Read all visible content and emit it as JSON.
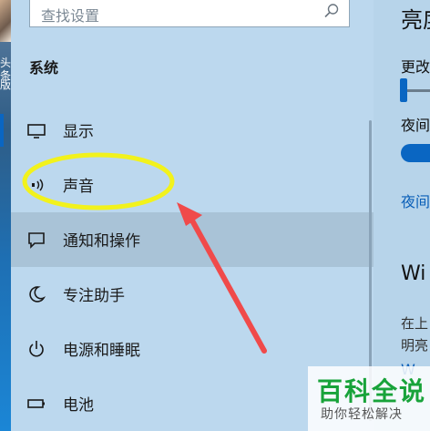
{
  "desktop": {
    "text1": "头条",
    "text2": "版"
  },
  "search": {
    "placeholder": "查找设置"
  },
  "section_title": "系统",
  "nav_items": [
    {
      "label": "显示",
      "icon": "monitor-icon"
    },
    {
      "label": "声音",
      "icon": "speaker-icon"
    },
    {
      "label": "通知和操作",
      "icon": "notification-icon"
    },
    {
      "label": "专注助手",
      "icon": "moon-icon"
    },
    {
      "label": "电源和睡眠",
      "icon": "power-icon"
    },
    {
      "label": "电池",
      "icon": "battery-icon"
    }
  ],
  "content": {
    "heading": "亮度",
    "change_label": "更改",
    "night_label": "夜间",
    "night_link": "夜间",
    "windows_heading": "Wi",
    "text_line1": "在上",
    "text_line2": "明亮",
    "link_bottom": "W"
  },
  "watermark": {
    "title": "百科全说",
    "subtitle": "助你轻松解决"
  },
  "colors": {
    "accent": "#0a66c2",
    "annotation_yellow": "#f2f21c",
    "annotation_red": "#f04a4a"
  }
}
